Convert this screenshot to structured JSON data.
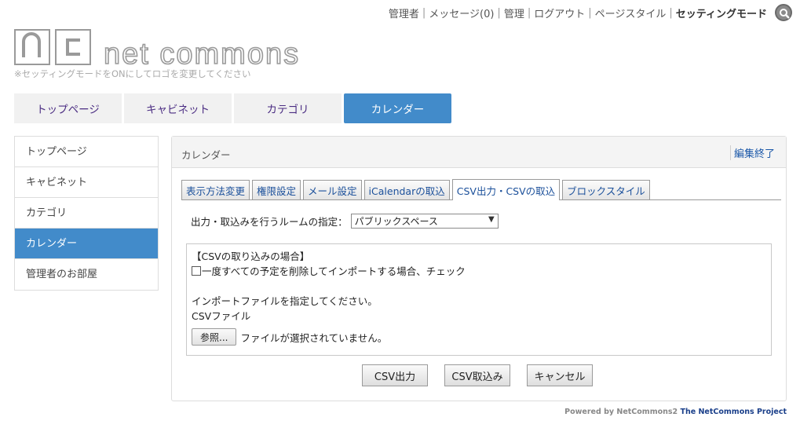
{
  "topmenu": {
    "items": [
      "管理者",
      "メッセージ(0)",
      "管理",
      "ログアウト",
      "ページスタイル"
    ],
    "setting_mode": "セッティングモード"
  },
  "logo": {
    "text": "net commons",
    "note": "※セッティングモードをONにしてロゴを変更してください"
  },
  "main_tabs": [
    {
      "label": "トップページ"
    },
    {
      "label": "キャビネット"
    },
    {
      "label": "カテゴリ"
    },
    {
      "label": "カレンダー",
      "active": true
    }
  ],
  "sidebar": {
    "items": [
      {
        "label": "トップページ"
      },
      {
        "label": "キャビネット"
      },
      {
        "label": "カテゴリ"
      },
      {
        "label": "カレンダー",
        "active": true
      },
      {
        "label": "管理者のお部屋"
      }
    ]
  },
  "panel": {
    "title": "カレンダー",
    "edit_end": "編集終了",
    "tabs": [
      {
        "label": "表示方法変更"
      },
      {
        "label": "権限設定"
      },
      {
        "label": "メール設定"
      },
      {
        "label": "iCalendarの取込"
      },
      {
        "label": "CSV出力・CSVの取込",
        "active": true
      },
      {
        "label": "ブロックスタイル"
      }
    ],
    "room_label": "出力・取込みを行うルームの指定：",
    "room_value": "パブリックスペース",
    "csv_box": {
      "heading": "【CSVの取り込みの場合】",
      "checkbox_label": "一度すべての予定を削除してインポートする場合、チェック",
      "instruction": "インポートファイルを指定してください。",
      "file_label": "CSVファイル",
      "browse_label": "参照...",
      "file_status": "ファイルが選択されていません。"
    },
    "buttons": {
      "export": "CSV出力",
      "import": "CSV取込み",
      "cancel": "キャンセル"
    }
  },
  "footer": {
    "powered": "Powered by NetCommons2",
    "project": "The NetCommons Project"
  },
  "colors": {
    "accent": "#428bca",
    "tab_text": "#4a2c82",
    "link": "#1a57a8"
  }
}
